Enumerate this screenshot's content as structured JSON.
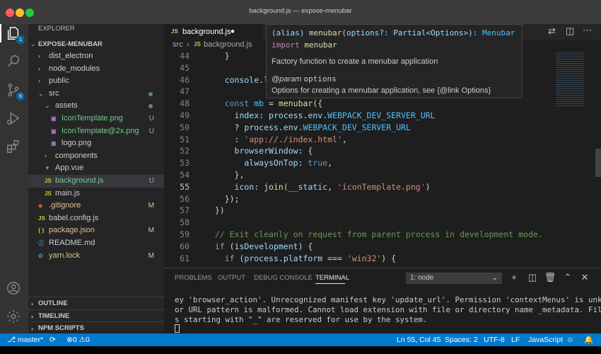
{
  "window": {
    "title": "background.js — expose-menubar"
  },
  "activity_bar": {
    "explorer_badge": "1",
    "scm_badge": "6"
  },
  "sidebar": {
    "header": "EXPLORER",
    "project": "EXPOSE-MENUBAR",
    "tree": [
      {
        "label": "dist_electron",
        "kind": "folder",
        "indent": 0
      },
      {
        "label": "node_modules",
        "kind": "folder",
        "indent": 0
      },
      {
        "label": "public",
        "kind": "folder",
        "indent": 0
      },
      {
        "label": "src",
        "kind": "folder-open",
        "indent": 0,
        "status": "dot"
      },
      {
        "label": "assets",
        "kind": "folder-open",
        "indent": 1,
        "status": "dot"
      },
      {
        "label": "IconTemplate.png",
        "kind": "image",
        "indent": 2,
        "status": "U"
      },
      {
        "label": "IconTemplate@2x.png",
        "kind": "image",
        "indent": 2,
        "status": "U"
      },
      {
        "label": "logo.png",
        "kind": "image",
        "indent": 2
      },
      {
        "label": "components",
        "kind": "folder",
        "indent": 1
      },
      {
        "label": "App.vue",
        "kind": "vue",
        "indent": 1
      },
      {
        "label": "background.js",
        "kind": "js",
        "indent": 1,
        "status": "U",
        "selected": true
      },
      {
        "label": "main.js",
        "kind": "js",
        "indent": 1
      },
      {
        "label": ".gitignore",
        "kind": "git",
        "indent": 0,
        "status": "M"
      },
      {
        "label": "babel.config.js",
        "kind": "js",
        "indent": 0
      },
      {
        "label": "package.json",
        "kind": "json",
        "indent": 0,
        "status": "M"
      },
      {
        "label": "README.md",
        "kind": "md",
        "indent": 0
      },
      {
        "label": "yarn.lock",
        "kind": "yarn",
        "indent": 0,
        "status": "M"
      }
    ],
    "sections": [
      "OUTLINE",
      "TIMELINE",
      "NPM SCRIPTS"
    ]
  },
  "editor": {
    "tab_label": "background.js",
    "breadcrumb": [
      "src",
      "background.js"
    ],
    "lines": [
      {
        "n": "44",
        "tokens": [
          [
            "pl",
            "    }"
          ]
        ]
      },
      {
        "n": "45",
        "tokens": [
          [
            "pl",
            ""
          ]
        ]
      },
      {
        "n": "46",
        "tokens": [
          [
            "var",
            "    console"
          ],
          [
            "pl",
            "."
          ],
          [
            "fn",
            "log"
          ]
        ]
      },
      {
        "n": "47",
        "tokens": [
          [
            "pl",
            ""
          ]
        ]
      },
      {
        "n": "48",
        "tokens": [
          [
            "kw",
            "    const "
          ],
          [
            "const",
            "mb"
          ],
          [
            "pl",
            " = "
          ],
          [
            "fn",
            "menubar"
          ],
          [
            "pl",
            "({"
          ]
        ]
      },
      {
        "n": "49",
        "tokens": [
          [
            "var",
            "      index"
          ],
          [
            "pl",
            ": "
          ],
          [
            "var",
            "process"
          ],
          [
            "pl",
            "."
          ],
          [
            "var",
            "env"
          ],
          [
            "pl",
            "."
          ],
          [
            "const",
            "WEBPACK_DEV_SERVER_URL"
          ]
        ]
      },
      {
        "n": "50",
        "tokens": [
          [
            "pl",
            "      ? "
          ],
          [
            "var",
            "process"
          ],
          [
            "pl",
            "."
          ],
          [
            "var",
            "env"
          ],
          [
            "pl",
            "."
          ],
          [
            "const",
            "WEBPACK_DEV_SERVER_URL"
          ]
        ]
      },
      {
        "n": "51",
        "tokens": [
          [
            "pl",
            "      : "
          ],
          [
            "str",
            "'app://./index.html'"
          ],
          [
            "pl",
            ","
          ]
        ]
      },
      {
        "n": "52",
        "tokens": [
          [
            "var",
            "      browserWindow"
          ],
          [
            "pl",
            ": {"
          ]
        ]
      },
      {
        "n": "53",
        "tokens": [
          [
            "var",
            "        alwaysOnTop"
          ],
          [
            "pl",
            ": "
          ],
          [
            "kw",
            "true"
          ],
          [
            "pl",
            ","
          ]
        ]
      },
      {
        "n": "54",
        "tokens": [
          [
            "pl",
            "      },"
          ]
        ]
      },
      {
        "n": "55",
        "tokens": [
          [
            "var",
            "      icon"
          ],
          [
            "pl",
            ": "
          ],
          [
            "fn",
            "join"
          ],
          [
            "pl",
            "("
          ],
          [
            "var",
            "__static"
          ],
          [
            "pl",
            ", "
          ],
          [
            "str",
            "'iconTemplate.png'"
          ],
          [
            "pl",
            ")"
          ]
        ]
      },
      {
        "n": "56",
        "tokens": [
          [
            "pl",
            "    });"
          ]
        ]
      },
      {
        "n": "57",
        "tokens": [
          [
            "pl",
            "  })"
          ]
        ]
      },
      {
        "n": "58",
        "tokens": [
          [
            "pl",
            ""
          ]
        ]
      },
      {
        "n": "59",
        "tokens": [
          [
            "cm",
            "  // Exit cleanly on request from parent process in development mode."
          ]
        ]
      },
      {
        "n": "60",
        "tokens": [
          [
            "kw2",
            "  if "
          ],
          [
            "pl",
            "("
          ],
          [
            "var",
            "isDevelopment"
          ],
          [
            "pl",
            ") {"
          ]
        ]
      },
      {
        "n": "61",
        "tokens": [
          [
            "kw2",
            "    if "
          ],
          [
            "pl",
            "("
          ],
          [
            "var",
            "process"
          ],
          [
            "pl",
            "."
          ],
          [
            "var",
            "platform"
          ],
          [
            "pl",
            " === "
          ],
          [
            "str",
            "'win32'"
          ],
          [
            "pl",
            ") {"
          ]
        ]
      }
    ]
  },
  "hover": {
    "signature_prefix": "(alias) ",
    "signature_fn": "menubar",
    "signature_params": "(options?: Partial<Options>): ",
    "signature_ret": "Menubar",
    "import_kw": "import ",
    "import_name": "menubar",
    "description": "Factory function to create a menubar application",
    "param_tag": "@param",
    "param_name": "options",
    "param_desc": "Options for creating a menubar application, see {@link Options}"
  },
  "panel": {
    "tabs": [
      "PROBLEMS",
      "OUTPUT",
      "DEBUG CONSOLE",
      "TERMINAL"
    ],
    "active_tab": "TERMINAL",
    "terminal_select": "1: node",
    "terminal_lines": [
      "ey 'browser_action'. Unrecognized manifest key 'update_url'. Permission 'contextMenus' is unknown",
      "or URL pattern is malformed. Cannot load extension with file or directory name _metadata. Filename",
      "s starting with \"_\" are reserved for use by the system."
    ]
  },
  "statusbar": {
    "branch": "master*",
    "errors": "0",
    "warnings": "0",
    "position": "Ln 55, Col 45",
    "spaces": "Spaces: 2",
    "encoding": "UTF-8",
    "eol": "LF",
    "language": "JavaScript"
  }
}
